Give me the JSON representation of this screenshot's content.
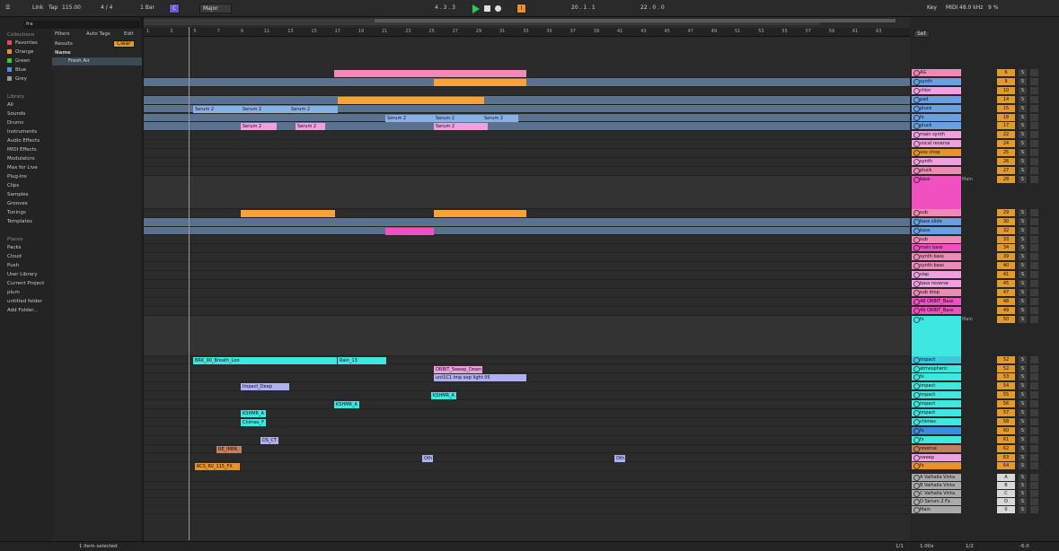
{
  "transport": {
    "link": "Link",
    "tap": "Tap",
    "tempo": "115.00",
    "time_sig": "4 / 4",
    "quant": "1 Bar",
    "key": "C",
    "scale": "Major",
    "position": "4 . 3 . 3",
    "loop_start": "20 . 1 . 1",
    "loop_len": "22 . 0 . 0",
    "key_label": "Key",
    "midi_label": "MIDI",
    "sample_rate": "48.0 kHz",
    "cpu": "9 %"
  },
  "browser": {
    "search": "fra",
    "filters": "Filters",
    "auto_tags": "Auto Tags",
    "edit": "Edit",
    "results_label": "Results",
    "clear": "Clear",
    "name_col": "Name",
    "result_item": "Fresh Air",
    "collections_head": "Collections",
    "collections": [
      {
        "label": "Favorites",
        "color": "#e45"
      },
      {
        "label": "Orange",
        "color": "#e8922c"
      },
      {
        "label": "Green",
        "color": "#3c3"
      },
      {
        "label": "Blue",
        "color": "#4a8ee8"
      },
      {
        "label": "Grey",
        "color": "#999"
      }
    ],
    "library_head": "Library",
    "library": [
      "All",
      "Sounds",
      "Drums",
      "Instruments",
      "Audio Effects",
      "MIDI Effects",
      "Modulators",
      "Max for Live",
      "Plug-Ins",
      "Clips",
      "Samples",
      "Grooves",
      "Tunings",
      "Templates"
    ],
    "places_head": "Places",
    "places": [
      "Packs",
      "Cloud",
      "Push",
      "User Library",
      "Current Project",
      "plum",
      "untitled folder",
      "Add Folder..."
    ]
  },
  "ruler": [
    "1",
    "3",
    "5",
    "7",
    "9",
    "11",
    "13",
    "15",
    "17",
    "19",
    "21",
    "23",
    "25",
    "27",
    "29",
    "31",
    "33",
    "35",
    "37",
    "39",
    "41",
    "43",
    "45",
    "47",
    "49",
    "51",
    "53",
    "55",
    "57",
    "59",
    "61",
    "63"
  ],
  "time_ruler": [
    "0:00",
    "0:10",
    "0:20",
    "0:30",
    "0:40",
    "0:50",
    "1:00",
    "1:10",
    "1:20",
    "1:30",
    "1:40",
    "1:50",
    "2:00",
    "2:10"
  ],
  "clips": {
    "serum": "Serum 2",
    "serum2": "Serum 2",
    "brk": "BRK_90_Breath_Loo",
    "rain": "Rain_13",
    "rain2": "Rain_13",
    "orbit": "ORBIT_Sweep_Down",
    "sweep": "unt1C1 Imp exp light 05",
    "impact": "Impact_Deep",
    "kshmr": "KSHMR_A",
    "kshmr2": "KSHMR_A",
    "kshmr3": "KSHMR_A",
    "chimes": "Chimes_F",
    "ds": "DS_CT",
    "re": "RE_IMPA",
    "rcs": "RCS_RV_115_FX",
    "oth": "Oth"
  },
  "tracks": [
    {
      "name": "AG",
      "n": "6",
      "c": "#f088b8"
    },
    {
      "name": "synth",
      "n": "9",
      "c": "#6aa0e0"
    },
    {
      "name": "chlor",
      "n": "10",
      "c": "#f0a0e0"
    },
    {
      "name": "pad",
      "n": "14",
      "c": "#6aa0e0"
    },
    {
      "name": "pluck",
      "n": "15",
      "c": "#6aa0e0"
    },
    {
      "name": "fx",
      "n": "18",
      "c": "#6aa0e0"
    },
    {
      "name": "pluck",
      "n": "17",
      "c": "#6aa0e0"
    },
    {
      "name": "main synth",
      "n": "22",
      "c": "#f0a0e0"
    },
    {
      "name": "vocal reverse",
      "n": "24",
      "c": "#f0a0e0"
    },
    {
      "name": "vox chop",
      "n": "25",
      "c": "#e8922c"
    },
    {
      "name": "synth",
      "n": "26",
      "c": "#f0a0e0"
    },
    {
      "name": "pluck",
      "n": "27",
      "c": "#f088b8"
    },
    {
      "name": "bass",
      "n": "28",
      "c": "#f050c0",
      "group": true,
      "route": "Main"
    },
    {
      "name": "sub",
      "n": "29",
      "c": "#f088b8"
    },
    {
      "name": "bass slide",
      "n": "30",
      "c": "#6aa0e0"
    },
    {
      "name": "bass",
      "n": "32",
      "c": "#6aa0e0"
    },
    {
      "name": "sub",
      "n": "33",
      "c": "#f088b8"
    },
    {
      "name": "main bass",
      "n": "34",
      "c": "#f050c0"
    },
    {
      "name": "synth bass",
      "n": "39",
      "c": "#f088b8"
    },
    {
      "name": "synth bass",
      "n": "40",
      "c": "#f088b8"
    },
    {
      "name": "slap",
      "n": "41",
      "c": "#f0a0e0"
    },
    {
      "name": "bass reverse",
      "n": "45",
      "c": "#f0a0e0"
    },
    {
      "name": "sub drop",
      "n": "47",
      "c": "#f088b8"
    },
    {
      "name": "48 ORBIT_Bass",
      "n": "48",
      "c": "#f050c0"
    },
    {
      "name": "49 ORBIT_Bass",
      "n": "49",
      "c": "#f050c0"
    },
    {
      "name": "fx",
      "n": "50",
      "c": "#3ee8e0",
      "group": true,
      "route": "Main"
    },
    {
      "name": "impact",
      "n": "52",
      "c": "#3ec8e0"
    },
    {
      "name": "atmospheric",
      "n": "52",
      "c": "#3ee8e0"
    },
    {
      "name": "fx",
      "n": "53",
      "c": "#3ee8e0"
    },
    {
      "name": "impact",
      "n": "54",
      "c": "#3ee8e0"
    },
    {
      "name": "impact",
      "n": "55",
      "c": "#3ee8e0"
    },
    {
      "name": "impact",
      "n": "56",
      "c": "#3ee8e0"
    },
    {
      "name": "impact",
      "n": "57",
      "c": "#3ee8e0"
    },
    {
      "name": "chimes",
      "n": "58",
      "c": "#3ee8e0"
    },
    {
      "name": "fx",
      "n": "60",
      "c": "#3a8ee0"
    },
    {
      "name": "fx",
      "n": "61",
      "c": "#3ee8e0"
    },
    {
      "name": "reverse",
      "n": "62",
      "c": "#c08060"
    },
    {
      "name": "sweep",
      "n": "63",
      "c": "#f0a0e0"
    },
    {
      "name": "fx",
      "n": "64",
      "c": "#e8922c"
    },
    {
      "name": "A Valhalla Vinta",
      "n": "A",
      "c": "#aaa",
      "ret": true
    },
    {
      "name": "B Valhalla Vinta",
      "n": "B",
      "c": "#aaa",
      "ret": true
    },
    {
      "name": "C Valhalla Vinta",
      "n": "C",
      "c": "#aaa",
      "ret": true
    },
    {
      "name": "D Serum 2 Fx",
      "n": "D",
      "c": "#aaa",
      "ret": true
    },
    {
      "name": "Main",
      "n": "0",
      "c": "#aaa",
      "main": true
    }
  ],
  "status": {
    "selected": "1 item selected",
    "page": "1/1",
    "zoom": "1.00x",
    "route": "1/2",
    "vol": "-6.0"
  }
}
